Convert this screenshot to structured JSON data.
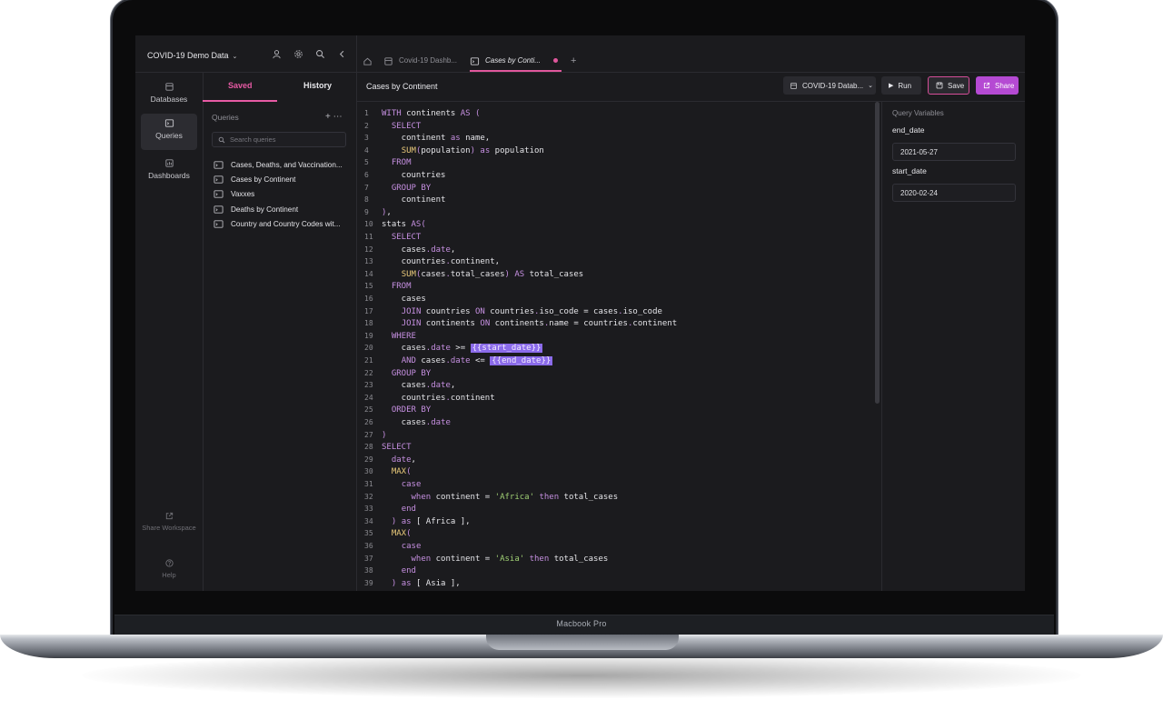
{
  "device": {
    "model_label": "Macbook Pro"
  },
  "topbar": {
    "project_name": "COVID-19 Demo Data",
    "icons": [
      "user-icon",
      "gear-icon",
      "search-icon",
      "chevron-left-icon"
    ]
  },
  "tabs": [
    {
      "label": "Covid-19 Dashb...",
      "active": false
    },
    {
      "label": "Cases by Conti...",
      "active": true,
      "unsaved": true
    }
  ],
  "sidebar": {
    "items": [
      {
        "label": "Databases",
        "icon": "database-icon",
        "active": false
      },
      {
        "label": "Queries",
        "icon": "terminal-icon",
        "active": true
      },
      {
        "label": "Dashboards",
        "icon": "chart-icon",
        "active": false
      }
    ],
    "share_workspace": "Share Workspace",
    "help": "Help"
  },
  "query_panel": {
    "tabs": {
      "saved": "Saved",
      "history": "History"
    },
    "header": "Queries",
    "search_placeholder": "Search queries",
    "items": [
      "Cases, Deaths, and Vaccination...",
      "Cases by Continent",
      "Vaxxes",
      "Deaths by Continent",
      "Country and Country Codes wit..."
    ]
  },
  "editor": {
    "title": "Cases by Continent",
    "database": "COVID-19 Datab...",
    "run_label": "Run",
    "save_label": "Save",
    "share_label": "Share",
    "code_lines": [
      "WITH continents AS (",
      "  SELECT",
      "    continent as name,",
      "    SUM(population) as population",
      "  FROM",
      "    countries",
      "  GROUP BY",
      "    continent",
      "),",
      "stats AS(",
      "  SELECT",
      "    cases.date,",
      "    countries.continent,",
      "    SUM(cases.total_cases) AS total_cases",
      "  FROM",
      "    cases",
      "    JOIN countries ON countries.iso_code = cases.iso_code",
      "    JOIN continents ON continents.name = countries.continent",
      "  WHERE",
      "    cases.date >= {{start_date}}",
      "    AND cases.date <= {{end_date}}",
      "  GROUP BY",
      "    cases.date,",
      "    countries.continent",
      "  ORDER BY",
      "    cases.date",
      ")",
      "SELECT",
      "  date,",
      "  MAX(",
      "    case",
      "      when continent = 'Africa' then total_cases",
      "    end",
      "  ) as [ Africa ],",
      "  MAX(",
      "    case",
      "      when continent = 'Asia' then total_cases",
      "    end",
      "  ) as [ Asia ],"
    ]
  },
  "variables": {
    "title": "Query Variables",
    "items": [
      {
        "name": "end_date",
        "value": "2021-05-27"
      },
      {
        "name": "start_date",
        "value": "2020-02-24"
      }
    ]
  },
  "colors": {
    "accent": "#e75aa4",
    "share_button": "#b54ad3",
    "keyword": "#c58fe0",
    "function": "#e9c97a",
    "string": "#9fcf74",
    "variable_highlight": "#8b6bea"
  }
}
